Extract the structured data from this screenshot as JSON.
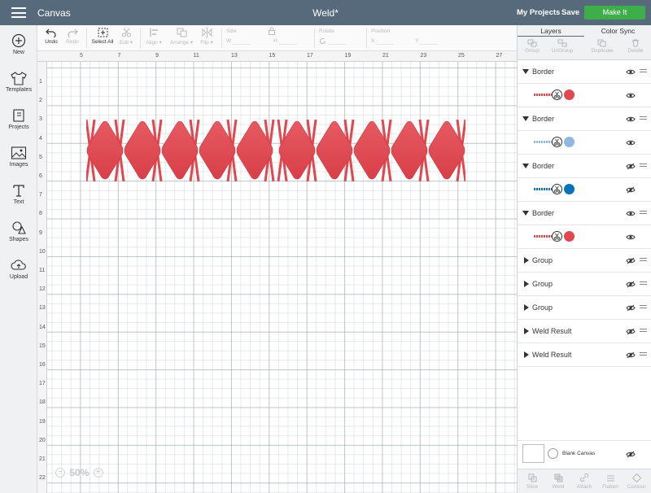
{
  "topbar": {
    "app_title": "Canvas",
    "doc_title": "Weld*",
    "my_projects": "My Projects",
    "save": "Save",
    "make_it": "Make It"
  },
  "left_tools": [
    {
      "label": "New",
      "icon": "plus-circle-icon"
    },
    {
      "label": "Templates",
      "icon": "tshirt-icon"
    },
    {
      "label": "Projects",
      "icon": "projects-icon"
    },
    {
      "label": "Images",
      "icon": "image-icon"
    },
    {
      "label": "Text",
      "icon": "text-icon"
    },
    {
      "label": "Shapes",
      "icon": "shapes-icon"
    },
    {
      "label": "Upload",
      "icon": "upload-cloud-icon"
    }
  ],
  "toolbar": {
    "undo": "Undo",
    "redo": "Redo",
    "select_all": "Select All",
    "edit": "Edit",
    "align": "Align",
    "arrange": "Arrange",
    "flip": "Flip",
    "size_label": "Size",
    "w_label": "W",
    "h_label": "H",
    "rotate_label": "Rotate",
    "position_label": "Position",
    "x_label": "X",
    "y_label": "Y"
  },
  "ruler": {
    "top": [
      "5",
      "7",
      "9",
      "11",
      "13",
      "15",
      "17",
      "19",
      "21",
      "23",
      "25",
      "27"
    ],
    "left": [
      "1",
      "2",
      "3",
      "4",
      "5",
      "6",
      "7",
      "8",
      "9",
      "10",
      "11",
      "12",
      "13",
      "14",
      "15",
      "16",
      "17",
      "18",
      "19",
      "20",
      "21",
      "22"
    ]
  },
  "canvas": {
    "zoom_minus": "−",
    "zoom": "50%",
    "zoom_plus": "+",
    "design_color": "#e0474f"
  },
  "panel": {
    "tab_layers": "Layers",
    "tab_color_sync": "Color Sync",
    "actions": [
      "Group",
      "UnGroup",
      "Duplicate",
      "Delete"
    ],
    "layers": [
      {
        "name": "Border",
        "expanded": true
      },
      {
        "name": "Border",
        "expanded": true
      },
      {
        "name": "Border",
        "expanded": true
      },
      {
        "name": "Border",
        "expanded": true
      },
      {
        "name": "Group",
        "expanded": false
      },
      {
        "name": "Group",
        "expanded": false
      },
      {
        "name": "Group",
        "expanded": false
      },
      {
        "name": "Weld Result",
        "expanded": false
      },
      {
        "name": "Weld Result",
        "expanded": false
      }
    ],
    "swatches": [
      "#e0474f",
      "#8fb8e0",
      "#0a72ba",
      "#e0474f"
    ],
    "blank_canvas": "Blank Canvas",
    "bottom_actions": [
      "Slice",
      "Weld",
      "Attach",
      "Flatten",
      "Contour"
    ]
  },
  "colors": {
    "topbar": "#566a7c",
    "make_it": "#3dae49",
    "accent": "#e0474f"
  }
}
